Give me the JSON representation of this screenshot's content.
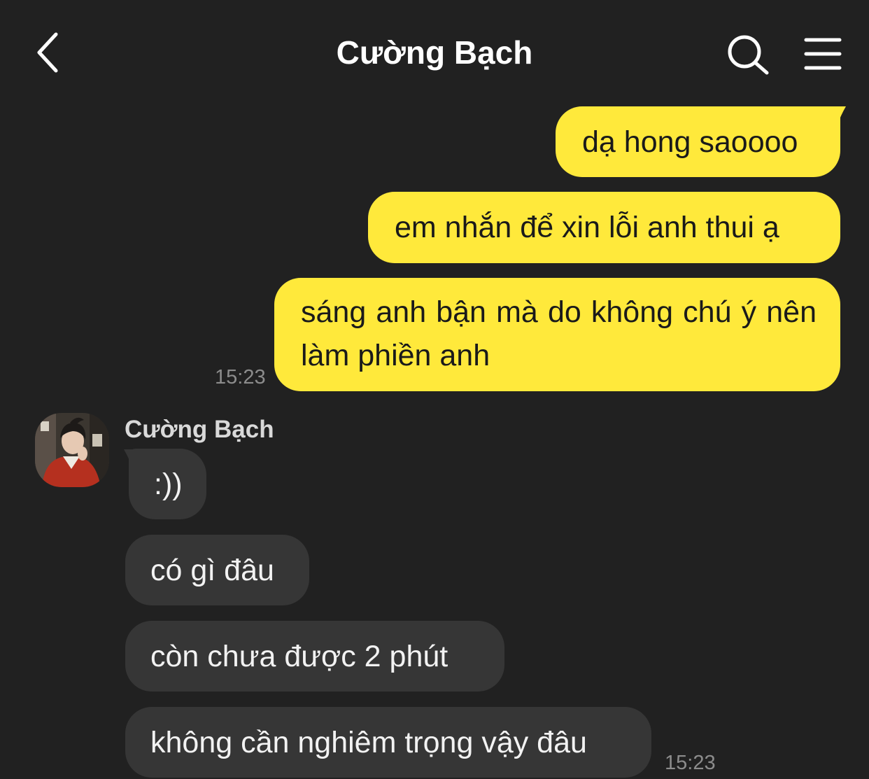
{
  "header": {
    "title": "Cường Bạch",
    "back_icon": "chevron-left-icon",
    "search_icon": "search-icon",
    "menu_icon": "hamburger-menu-icon"
  },
  "outgoing": {
    "messages": [
      "dạ hong saoooo",
      "em nhắn để xin lỗi anh thui ạ",
      "sáng anh bận mà do không chú ý nên làm phiền anh"
    ],
    "time": "15:23"
  },
  "incoming": {
    "sender": "Cường Bạch",
    "messages": [
      ":))",
      "có gì đâu",
      "còn chưa được 2 phút",
      "không cần nghiêm trọng vậy đâu"
    ],
    "time": "15:23"
  },
  "colors": {
    "background": "#212121",
    "outgoing_bubble": "#ffe93b",
    "incoming_bubble": "#363636",
    "timestamp": "#8c8c8c"
  }
}
